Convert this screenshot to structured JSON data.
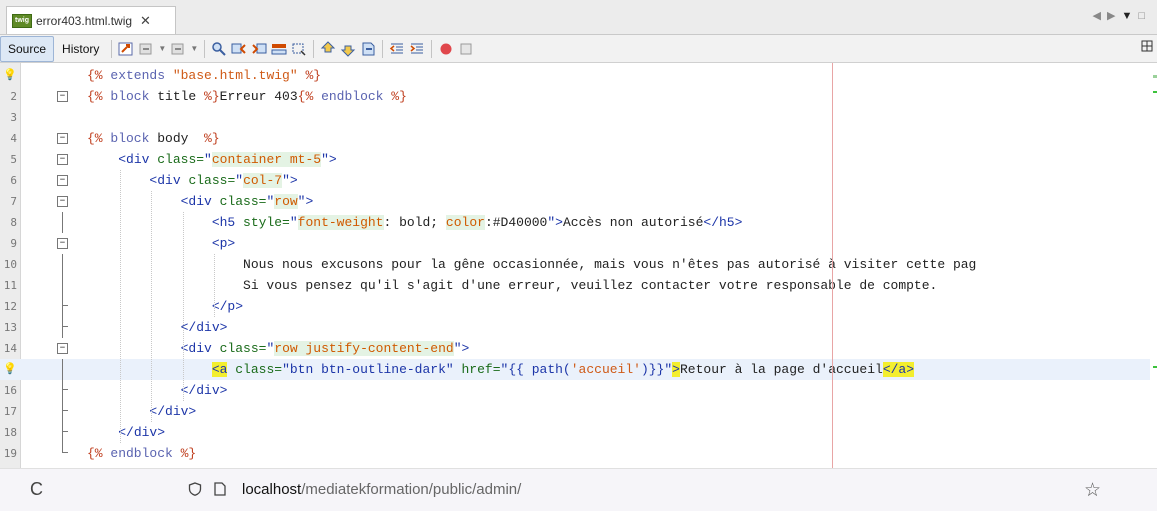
{
  "tab": {
    "file_icon_text": "twig",
    "title": "error403.html.twig",
    "close": "✕"
  },
  "toolbar": {
    "source": "Source",
    "history": "History"
  },
  "editor": {
    "lines": [
      {
        "n": "1",
        "marker": "bulb",
        "segs": [
          [
            "tw",
            "{% "
          ],
          [
            "kw",
            "extends "
          ],
          [
            "str",
            "\"base.html.twig\""
          ],
          [
            "tw",
            " %}"
          ]
        ]
      },
      {
        "n": "2",
        "fold": "box",
        "segs": [
          [
            "tw",
            "{% "
          ],
          [
            "kw",
            "block "
          ],
          [
            "txt",
            "title "
          ],
          [
            "tw",
            "%}"
          ],
          [
            "txt",
            "Erreur 403"
          ],
          [
            "tw",
            "{% "
          ],
          [
            "kw",
            "endblock"
          ],
          [
            "tw",
            " %}"
          ]
        ]
      },
      {
        "n": "3",
        "segs": []
      },
      {
        "n": "4",
        "fold": "box",
        "segs": [
          [
            "tw",
            "{% "
          ],
          [
            "kw",
            "block "
          ],
          [
            "txt",
            "body  "
          ],
          [
            "tw",
            "%}"
          ]
        ]
      },
      {
        "n": "5",
        "fold": "box",
        "segs": [
          [
            "txt",
            "    "
          ],
          [
            "tag",
            "<div "
          ],
          [
            "attr",
            "class="
          ],
          [
            "tag",
            "\""
          ],
          [
            "val",
            "container mt-5"
          ],
          [
            "tag",
            "\">"
          ]
        ]
      },
      {
        "n": "6",
        "fold": "box",
        "segs": [
          [
            "txt",
            "        "
          ],
          [
            "tag",
            "<div "
          ],
          [
            "attr",
            "class="
          ],
          [
            "tag",
            "\""
          ],
          [
            "val",
            "col-7"
          ],
          [
            "tag",
            "\">"
          ]
        ]
      },
      {
        "n": "7",
        "fold": "box",
        "segs": [
          [
            "txt",
            "            "
          ],
          [
            "tag",
            "<div "
          ],
          [
            "attr",
            "class="
          ],
          [
            "tag",
            "\""
          ],
          [
            "val",
            "row"
          ],
          [
            "tag",
            "\">"
          ]
        ]
      },
      {
        "n": "8",
        "segs": [
          [
            "txt",
            "                "
          ],
          [
            "tag",
            "<h5 "
          ],
          [
            "attr",
            "style="
          ],
          [
            "tag",
            "\""
          ],
          [
            "val",
            "font-weight"
          ],
          [
            "txt",
            ": bold; "
          ],
          [
            "val",
            "color"
          ],
          [
            "txt",
            ":#D40000"
          ],
          [
            "tag",
            "\">"
          ],
          [
            "txt",
            "Accès non autorisé"
          ],
          [
            "tag",
            "</h5>"
          ]
        ]
      },
      {
        "n": "9",
        "fold": "box",
        "segs": [
          [
            "txt",
            "                "
          ],
          [
            "tag",
            "<p>"
          ]
        ]
      },
      {
        "n": "10",
        "segs": [
          [
            "txt",
            "                    Nous nous excusons pour la gêne occasionnée, mais vous n'êtes pas autorisé à visiter cette pag"
          ]
        ]
      },
      {
        "n": "11",
        "segs": [
          [
            "txt",
            "                    Si vous pensez qu'il s'agit d'une erreur, veuillez contacter votre responsable de compte."
          ]
        ]
      },
      {
        "n": "12",
        "fold": "end",
        "segs": [
          [
            "txt",
            "                "
          ],
          [
            "tag",
            "</p>"
          ]
        ]
      },
      {
        "n": "13",
        "fold": "end",
        "segs": [
          [
            "txt",
            "            "
          ],
          [
            "tag",
            "</div>"
          ]
        ]
      },
      {
        "n": "14",
        "fold": "box",
        "segs": [
          [
            "txt",
            "            "
          ],
          [
            "tag",
            "<div "
          ],
          [
            "attr",
            "class="
          ],
          [
            "tag",
            "\""
          ],
          [
            "val",
            "row justify-content-end"
          ],
          [
            "tag",
            "\">"
          ]
        ]
      },
      {
        "n": "15",
        "marker": "bulb",
        "current": true,
        "segs": [
          [
            "txt",
            "                "
          ],
          [
            "taghl",
            "<a"
          ],
          [
            "tag",
            " "
          ],
          [
            "attr",
            "class="
          ],
          [
            "tag",
            "\"btn btn-outline-dark\" "
          ],
          [
            "attr",
            "href="
          ],
          [
            "tag",
            "\"{{ path("
          ],
          [
            "str",
            "'accueil'"
          ],
          [
            "tag",
            ")}}\""
          ],
          [
            "taghl",
            ">"
          ],
          [
            "txt",
            "Retour à la page d'accueil"
          ],
          [
            "taghl",
            "</a>"
          ]
        ]
      },
      {
        "n": "16",
        "fold": "end",
        "segs": [
          [
            "txt",
            "            "
          ],
          [
            "tag",
            "</div>"
          ]
        ]
      },
      {
        "n": "17",
        "fold": "end",
        "segs": [
          [
            "txt",
            "        "
          ],
          [
            "tag",
            "</div>"
          ]
        ]
      },
      {
        "n": "18",
        "fold": "end",
        "segs": [
          [
            "txt",
            "    "
          ],
          [
            "tag",
            "</div>"
          ]
        ]
      },
      {
        "n": "19",
        "fold": "last",
        "segs": [
          [
            "tw",
            "{% "
          ],
          [
            "kw",
            "endblock"
          ],
          [
            "tw",
            " %}"
          ]
        ]
      }
    ]
  },
  "browser": {
    "url_host": "localhost",
    "url_path": "/mediatekformation/public/admin/"
  },
  "colors": {
    "twig": "#c04020",
    "keyword": "#5a63b0",
    "string": "#cf5a17",
    "tag": "#1c35a8",
    "attribute": "#1a6b1a",
    "highlight": "#f3ee2e",
    "current_line": "#eaf1fb"
  }
}
